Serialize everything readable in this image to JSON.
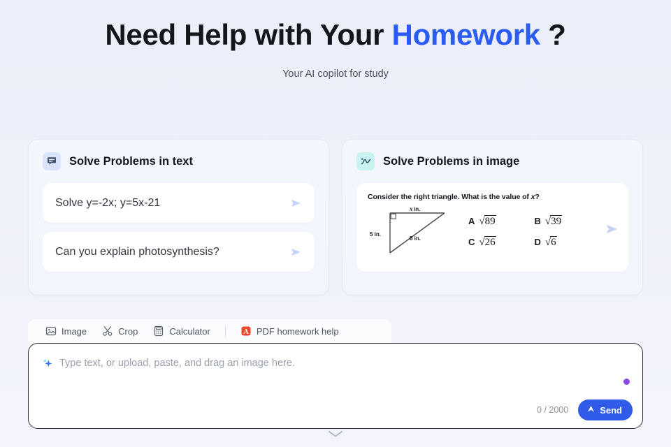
{
  "hero": {
    "title_part1": "Need Help with Your ",
    "title_accent": "Homework",
    "title_part2": " ?",
    "subtitle": "Your AI copilot for study",
    "accent_color": "#2b5bf5"
  },
  "cards": [
    {
      "title": "Solve Problems in text",
      "icon": "chat-text-icon",
      "icon_bg": "#dbe3fb",
      "prompts": [
        "Solve y=-2x; y=5x-21",
        "Can you explain photosynthesis?"
      ]
    },
    {
      "title": "Solve Problems in image",
      "icon": "function-curve-icon",
      "icon_bg": "#c9f3f1",
      "problem": {
        "question_pre": "Consider the right triangle.  What is the value of ",
        "question_var": "x",
        "question_post": "?",
        "figure": {
          "top_label": "x in.",
          "left_label": "5 in.",
          "hyp_label": "8 in.",
          "right_angle": true
        },
        "choices": [
          {
            "letter": "A",
            "value": "89"
          },
          {
            "letter": "B",
            "value": "39"
          },
          {
            "letter": "C",
            "value": "26"
          },
          {
            "letter": "D",
            "value": "6"
          }
        ]
      }
    }
  ],
  "toolbar": {
    "items": [
      {
        "label": "Image",
        "icon": "image-icon"
      },
      {
        "label": "Crop",
        "icon": "scissors-icon"
      },
      {
        "label": "Calculator",
        "icon": "calculator-icon"
      },
      {
        "label": "PDF homework help",
        "icon": "pdf-icon",
        "icon_color": "#f0472a"
      }
    ]
  },
  "composer": {
    "placeholder": "Type text, or upload, paste, and drag an image here.",
    "sparkle_icon": "sparkle-icon",
    "counter": "0 / 2000",
    "send_label": "Send",
    "send_color": "#2f5be8",
    "dot_color": "#8b49e8"
  },
  "footer": {
    "chevron": "chevron-down-icon"
  }
}
